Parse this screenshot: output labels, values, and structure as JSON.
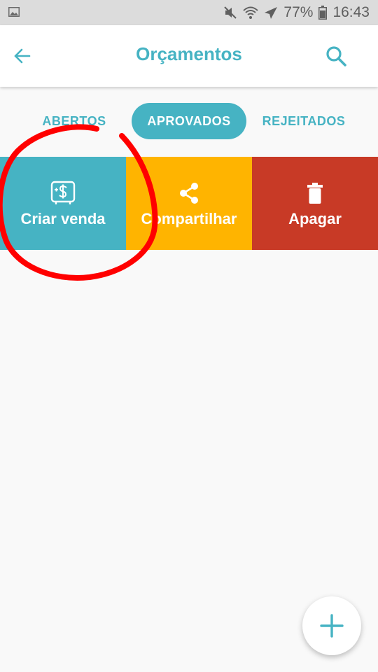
{
  "status_bar": {
    "battery": "77%",
    "time": "16:43",
    "icons": [
      "gallery-icon",
      "mute-icon",
      "wifi-icon",
      "airplane-icon",
      "battery-icon"
    ]
  },
  "app_bar": {
    "title": "Orçamentos",
    "icons": [
      "back-arrow-icon",
      "search-icon"
    ]
  },
  "tabs": [
    {
      "label": "ABERTOS",
      "selected": false
    },
    {
      "label": "APROVADOS",
      "selected": true
    },
    {
      "label": "REJEITADOS",
      "selected": false
    }
  ],
  "actions": [
    {
      "label": "Criar venda",
      "icon": "money-add-icon",
      "color": "#46b3c3"
    },
    {
      "label": "Compartilhar",
      "icon": "share-icon",
      "color": "#ffb400"
    },
    {
      "label": "Apagar",
      "icon": "trash-icon",
      "color": "#c83a26"
    }
  ],
  "fab": {
    "icon": "plus-icon"
  },
  "colors": {
    "accent": "#46b3c3",
    "share": "#ffb400",
    "delete": "#c83a26",
    "annotation": "#ff0000"
  }
}
